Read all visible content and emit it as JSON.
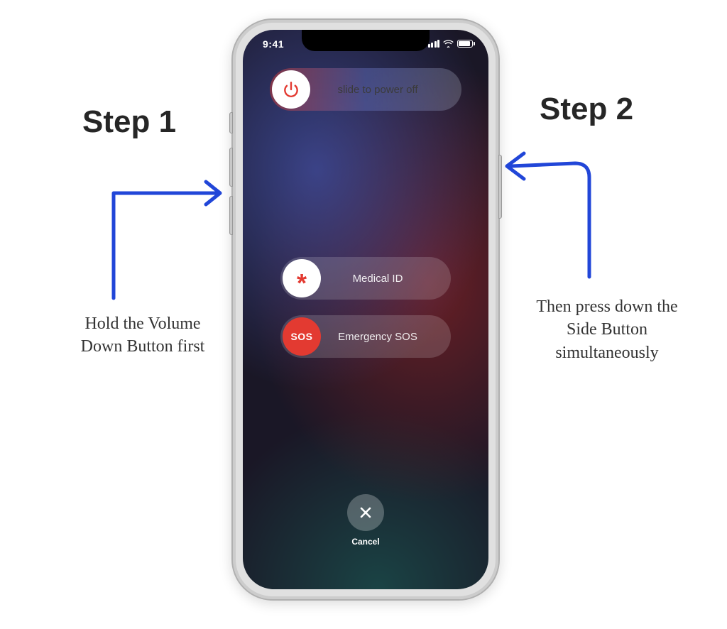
{
  "status": {
    "time": "9:41"
  },
  "sliders": {
    "power": {
      "label": "slide to power off"
    },
    "medical": {
      "label": "Medical ID",
      "asterisk": "*"
    },
    "sos": {
      "label": "Emergency SOS",
      "badge": "SOS"
    }
  },
  "cancel": {
    "label": "Cancel"
  },
  "annotations": {
    "step1": {
      "title": "Step 1",
      "text": "Hold the Volume Down Button first"
    },
    "step2": {
      "title": "Step 2",
      "text": "Then press down the Side Button simultaneously"
    }
  }
}
